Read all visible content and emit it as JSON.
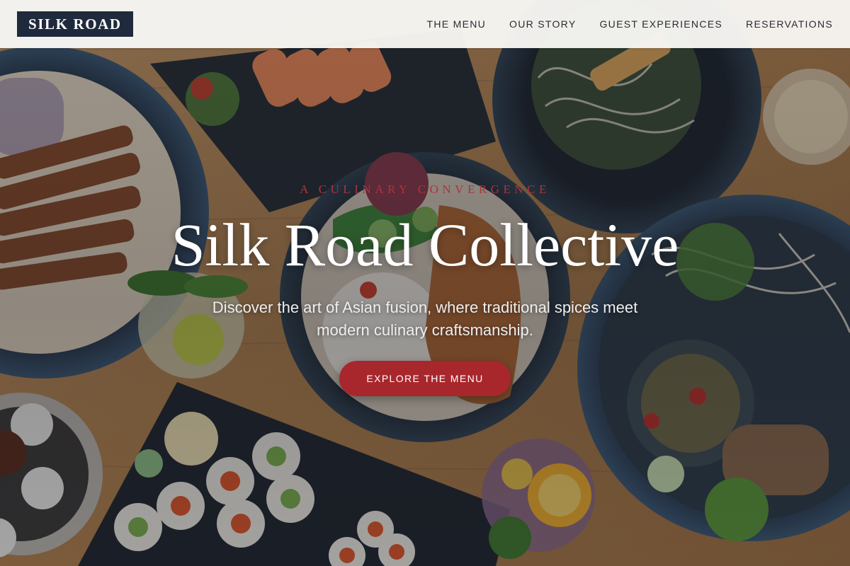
{
  "header": {
    "logo_text": "SILK ROAD",
    "nav": [
      {
        "label": "THE MENU"
      },
      {
        "label": "OUR STORY"
      },
      {
        "label": "GUEST EXPERIENCES"
      },
      {
        "label": "RESERVATIONS"
      }
    ]
  },
  "hero": {
    "eyebrow": "A CULINARY CONVERGENCE",
    "title": "Silk Road Collective",
    "subtitle": "Discover the art of Asian fusion, where traditional spices meet modern culinary craftsmanship.",
    "cta_label": "EXPLORE THE MENU"
  },
  "colors": {
    "logo_bg": "#1f2a3d",
    "accent": "#a8272d",
    "eyebrow": "#b0323a",
    "header_bg": "#f8f7f4",
    "table_wood": "#b98a5c"
  }
}
